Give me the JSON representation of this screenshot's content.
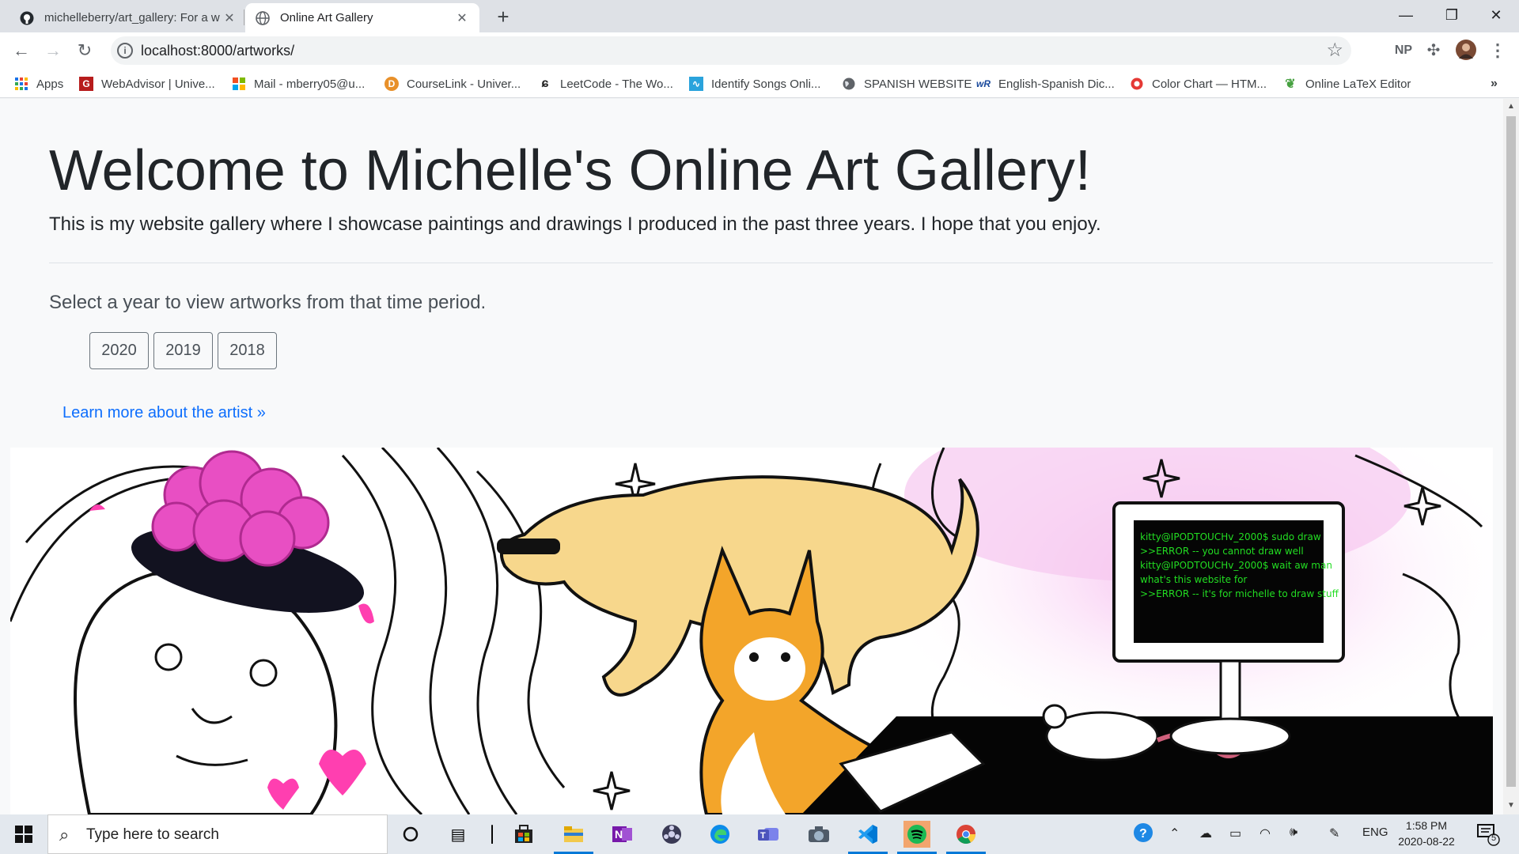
{
  "browser": {
    "tabs": [
      {
        "title": "michelleberry/art_gallery: For a w",
        "icon": "github-icon"
      },
      {
        "title": "Online Art Gallery",
        "icon": "globe-icon"
      }
    ],
    "url": "localhost:8000/artworks/",
    "profile_badge": "NP",
    "bookmarks": [
      {
        "label": "Apps",
        "icon": "apps-grid-icon"
      },
      {
        "label": "WebAdvisor | Unive...",
        "icon": "webadvisor-icon"
      },
      {
        "label": "Mail - mberry05@u...",
        "icon": "microsoft-icon"
      },
      {
        "label": "CourseLink - Univer...",
        "icon": "courselink-icon"
      },
      {
        "label": "LeetCode - The Wo...",
        "icon": "leetcode-icon"
      },
      {
        "label": "Identify Songs Onli...",
        "icon": "audio-wave-icon"
      },
      {
        "label": "SPANISH WEBSITE",
        "icon": "globe-icon"
      },
      {
        "label": "English-Spanish Dic...",
        "icon": "wordreference-icon"
      },
      {
        "label": "Color Chart — HTM...",
        "icon": "color-wheel-icon"
      },
      {
        "label": "Online LaTeX Editor",
        "icon": "overleaf-icon"
      }
    ]
  },
  "page": {
    "title": "Welcome to Michelle's Online Art Gallery!",
    "lead": "This is my website gallery where I showcase paintings and drawings I produced in the past three years. I hope that you enjoy.",
    "select_prompt": "Select a year to view artworks from that time period.",
    "years": [
      "2020",
      "2019",
      "2018"
    ],
    "learn_more": "Learn more about the artist »",
    "terminal_lines": [
      "kitty@IPODTOUCHv_2000$ sudo draw",
      ">>ERROR -- you cannot draw well",
      "kitty@IPODTOUCHv_2000$ wait aw man",
      "what's this website for",
      ">>ERROR -- it's for michelle to draw stuff"
    ]
  },
  "taskbar": {
    "search_placeholder": "Type here to search",
    "language": "ENG",
    "time": "1:58 PM",
    "date": "2020-08-22",
    "notification_count": "5"
  },
  "colors": {
    "link": "#0d6efd",
    "terminal_text": "#22dd22",
    "brain_pink": "#e84fc3",
    "cat_orange": "#f3a52a",
    "dog_yellow": "#f7d78c"
  }
}
